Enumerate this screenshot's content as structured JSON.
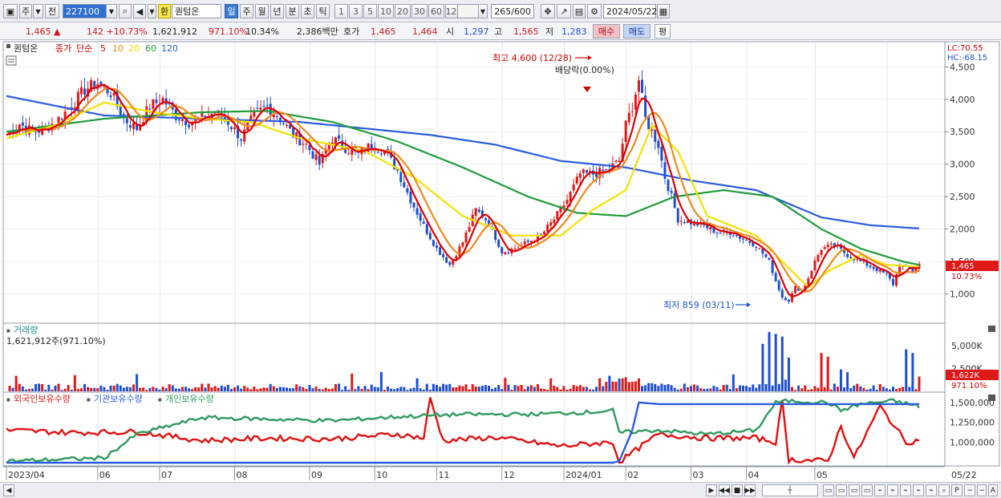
{
  "toolbar": {
    "market": "주",
    "prev_label": "전",
    "code": "227100",
    "han_label": "환",
    "name": "퀀텀온",
    "periods": [
      "일",
      "주",
      "월",
      "년",
      "분",
      "초",
      "틱"
    ],
    "active_period": "일",
    "intervals": [
      "1",
      "3",
      "5",
      "10",
      "20",
      "30",
      "60",
      "120"
    ],
    "count": "265/600",
    "date": "2024/05/22"
  },
  "quote": {
    "price": "1,465",
    "change": "142",
    "change_pct": "+10.73%",
    "volume": "1,621,912",
    "vol_ratio": "971.10%",
    "turnover": "10.34%",
    "amount": "2,386백만",
    "hoga_label": "호가",
    "ask": "1,465",
    "bid": "1,464",
    "open_label": "시",
    "open": "1,297",
    "high_label": "고",
    "high": "1,565",
    "low_label": "저",
    "low": "1,283",
    "buy_button": "매수",
    "sell_button": "매도",
    "eval_button": "평"
  },
  "legend": {
    "name": "퀀텀온",
    "close": "종가",
    "simple": "단순",
    "ma": [
      {
        "label": "5",
        "color": "#e00000"
      },
      {
        "label": "10",
        "color": "#f08a1a"
      },
      {
        "label": "20",
        "color": "#e8d800"
      },
      {
        "label": "60",
        "color": "#1e9c3a"
      },
      {
        "label": "120",
        "color": "#2a5ce0"
      }
    ]
  },
  "annotations": {
    "high": "최고 4,600 (12/28)",
    "dividend": "배당락(0.00%)",
    "low": "최저 859 (03/11)",
    "lc": "LC:70.55",
    "hc": "HC:-68.15",
    "price_tag": "1,465",
    "pct_tag": "10.73%",
    "vol_title": "거래량",
    "vol_value": "1,621,912주(971.10%)",
    "vol_tag": "1,622K",
    "vol_pct_tag": "971.10%",
    "holding_foreign": "외국인보유수량",
    "holding_inst": "기관보유수량",
    "holding_indiv": "개인보유수량"
  },
  "chart_data": {
    "type": "candlestick",
    "price_axis": {
      "ticks": [
        "1,000",
        "1,500",
        "2,000",
        "2,500",
        "3,000",
        "3,500",
        "4,000",
        "4,500"
      ],
      "ylim": [
        600,
        4800
      ]
    },
    "volume_axis": {
      "ticks": [
        "2,500K",
        "5,000K"
      ],
      "ylim": [
        0,
        7200
      ]
    },
    "holding_axis": {
      "ticks": [
        "1,000,000",
        "1,250,000",
        "1,500,000"
      ],
      "ylim": [
        720000,
        1600000
      ]
    },
    "x_ticks": [
      "2023/04",
      "06",
      "07",
      "08",
      "09",
      "10",
      "11",
      "12",
      "2024/01",
      "02",
      "03",
      "04",
      "05",
      "05/22"
    ],
    "price_path": [
      [
        0,
        3450
      ],
      [
        4,
        3620
      ],
      [
        8,
        3500
      ],
      [
        12,
        3550
      ],
      [
        16,
        3700
      ],
      [
        20,
        3900
      ],
      [
        24,
        4150
      ],
      [
        28,
        4250
      ],
      [
        32,
        4100
      ],
      [
        36,
        3700
      ],
      [
        40,
        3550
      ],
      [
        44,
        3900
      ],
      [
        48,
        4000
      ],
      [
        52,
        3750
      ],
      [
        56,
        3650
      ],
      [
        60,
        3700
      ],
      [
        64,
        3800
      ],
      [
        68,
        3650
      ],
      [
        72,
        3400
      ],
      [
        76,
        3750
      ],
      [
        80,
        3900
      ],
      [
        84,
        3700
      ],
      [
        88,
        3450
      ],
      [
        92,
        3300
      ],
      [
        96,
        3000
      ],
      [
        100,
        3400
      ],
      [
        104,
        3250
      ],
      [
        108,
        3150
      ],
      [
        112,
        3300
      ],
      [
        116,
        3200
      ],
      [
        120,
        2900
      ],
      [
        124,
        2450
      ],
      [
        128,
        2050
      ],
      [
        132,
        1700
      ],
      [
        136,
        1450
      ],
      [
        140,
        1800
      ],
      [
        144,
        2300
      ],
      [
        148,
        2100
      ],
      [
        152,
        1650
      ],
      [
        156,
        1700
      ],
      [
        160,
        1800
      ],
      [
        164,
        1900
      ],
      [
        168,
        2150
      ],
      [
        172,
        2450
      ],
      [
        176,
        2850
      ],
      [
        180,
        2850
      ],
      [
        184,
        2900
      ],
      [
        188,
        3050
      ],
      [
        190,
        3600
      ],
      [
        192,
        3900
      ],
      [
        194,
        4300
      ],
      [
        196,
        3700
      ],
      [
        198,
        3500
      ],
      [
        200,
        3300
      ],
      [
        202,
        2800
      ],
      [
        204,
        2500
      ],
      [
        206,
        2150
      ],
      [
        210,
        2100
      ],
      [
        214,
        2050
      ],
      [
        218,
        1950
      ],
      [
        222,
        1950
      ],
      [
        226,
        1850
      ],
      [
        230,
        1750
      ],
      [
        234,
        1500
      ],
      [
        236,
        1200
      ],
      [
        238,
        950
      ],
      [
        240,
        900
      ],
      [
        242,
        1100
      ],
      [
        244,
        1050
      ],
      [
        246,
        1250
      ],
      [
        248,
        1500
      ],
      [
        250,
        1700
      ],
      [
        254,
        1750
      ],
      [
        258,
        1600
      ],
      [
        262,
        1500
      ],
      [
        266,
        1400
      ],
      [
        270,
        1300
      ],
      [
        272,
        1150
      ],
      [
        274,
        1450
      ],
      [
        276,
        1400
      ],
      [
        278,
        1350
      ],
      [
        280,
        1465
      ]
    ],
    "ma120_path": [
      [
        0,
        4050
      ],
      [
        30,
        3750
      ],
      [
        60,
        3700
      ],
      [
        90,
        3650
      ],
      [
        110,
        3550
      ],
      [
        130,
        3450
      ],
      [
        150,
        3300
      ],
      [
        170,
        3050
      ],
      [
        190,
        2950
      ],
      [
        210,
        2750
      ],
      [
        230,
        2600
      ],
      [
        250,
        2180
      ],
      [
        265,
        2060
      ],
      [
        280,
        2010
      ]
    ],
    "ma60_path": [
      [
        0,
        3500
      ],
      [
        30,
        3700
      ],
      [
        60,
        3800
      ],
      [
        80,
        3820
      ],
      [
        100,
        3650
      ],
      [
        120,
        3350
      ],
      [
        140,
        2950
      ],
      [
        160,
        2500
      ],
      [
        175,
        2250
      ],
      [
        190,
        2200
      ],
      [
        205,
        2500
      ],
      [
        220,
        2600
      ],
      [
        235,
        2500
      ],
      [
        250,
        2000
      ],
      [
        262,
        1700
      ],
      [
        275,
        1500
      ],
      [
        280,
        1450
      ]
    ],
    "ma20_path": [
      [
        0,
        3400
      ],
      [
        15,
        3600
      ],
      [
        30,
        3950
      ],
      [
        45,
        3800
      ],
      [
        60,
        3700
      ],
      [
        75,
        3650
      ],
      [
        90,
        3400
      ],
      [
        110,
        3200
      ],
      [
        125,
        2800
      ],
      [
        140,
        2200
      ],
      [
        155,
        1900
      ],
      [
        170,
        1900
      ],
      [
        180,
        2300
      ],
      [
        190,
        2600
      ],
      [
        198,
        3600
      ],
      [
        206,
        3200
      ],
      [
        215,
        2200
      ],
      [
        230,
        1900
      ],
      [
        240,
        1400
      ],
      [
        246,
        1100
      ],
      [
        252,
        1350
      ],
      [
        262,
        1600
      ],
      [
        270,
        1450
      ],
      [
        280,
        1420
      ]
    ],
    "volume_bars": [
      [
        232,
        5200
      ],
      [
        234,
        6500
      ],
      [
        236,
        6300
      ],
      [
        238,
        6000
      ],
      [
        240,
        3700
      ],
      [
        250,
        4200
      ],
      [
        252,
        3800
      ],
      [
        256,
        2400
      ],
      [
        258,
        2100
      ],
      [
        276,
        4600
      ],
      [
        278,
        4200
      ],
      [
        280,
        1622
      ]
    ],
    "foreign_holding_path": [
      [
        0,
        1150000
      ],
      [
        20,
        1120000
      ],
      [
        40,
        1130000
      ],
      [
        60,
        1020000
      ],
      [
        80,
        1050000
      ],
      [
        100,
        1040000
      ],
      [
        120,
        1100000
      ],
      [
        128,
        1050000
      ],
      [
        130,
        1550000
      ],
      [
        134,
        1020000
      ],
      [
        150,
        1060000
      ],
      [
        170,
        950000
      ],
      [
        186,
        1000000
      ],
      [
        188,
        750000
      ],
      [
        200,
        1100000
      ],
      [
        215,
        1050000
      ],
      [
        230,
        1050000
      ],
      [
        236,
        1000000
      ],
      [
        238,
        1500000
      ],
      [
        240,
        780000
      ],
      [
        252,
        760000
      ],
      [
        256,
        1200000
      ],
      [
        260,
        800000
      ],
      [
        268,
        1450000
      ],
      [
        276,
        1000000
      ],
      [
        280,
        1020000
      ]
    ],
    "inst_holding_path": [
      [
        0,
        740000
      ],
      [
        186,
        740000
      ],
      [
        188,
        760000
      ],
      [
        192,
        1150000
      ],
      [
        194,
        1500000
      ],
      [
        200,
        1480000
      ],
      [
        280,
        1480000
      ]
    ],
    "indiv_holding_path": [
      [
        0,
        760000
      ],
      [
        30,
        800000
      ],
      [
        40,
        1100000
      ],
      [
        60,
        1310000
      ],
      [
        80,
        1290000
      ],
      [
        100,
        1270000
      ],
      [
        120,
        1320000
      ],
      [
        140,
        1350000
      ],
      [
        160,
        1350000
      ],
      [
        180,
        1380000
      ],
      [
        186,
        1400000
      ],
      [
        188,
        1120000
      ],
      [
        200,
        1150000
      ],
      [
        215,
        1100000
      ],
      [
        230,
        1150000
      ],
      [
        236,
        1500000
      ],
      [
        240,
        1520000
      ],
      [
        252,
        1500000
      ],
      [
        256,
        1400000
      ],
      [
        262,
        1480000
      ],
      [
        272,
        1520000
      ],
      [
        280,
        1450000
      ]
    ]
  }
}
